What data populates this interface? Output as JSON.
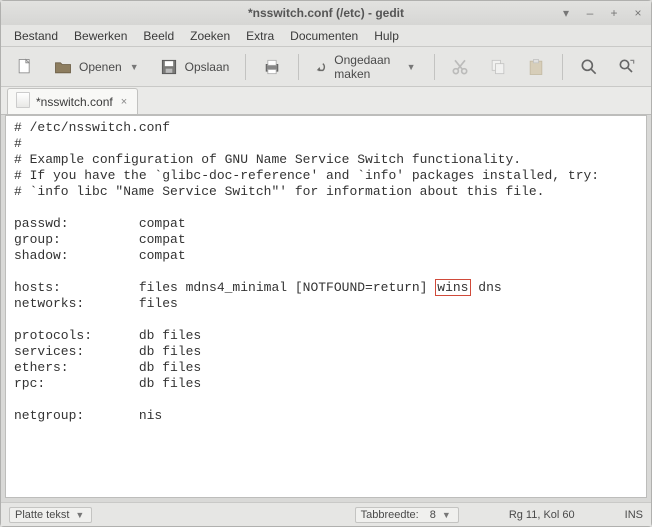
{
  "window": {
    "title": "*nsswitch.conf (/etc) - gedit"
  },
  "menu": {
    "items": [
      "Bestand",
      "Bewerken",
      "Beeld",
      "Zoeken",
      "Extra",
      "Documenten",
      "Hulp"
    ]
  },
  "toolbar": {
    "open_label": "Openen",
    "save_label": "Opslaan",
    "undo_label": "Ongedaan maken"
  },
  "tab": {
    "label": "*nsswitch.conf"
  },
  "editor": {
    "lines": [
      "# /etc/nsswitch.conf",
      "#",
      "# Example configuration of GNU Name Service Switch functionality.",
      "# If you have the `glibc-doc-reference' and `info' packages installed, try:",
      "# `info libc \"Name Service Switch\"' for information about this file.",
      "",
      "passwd:         compat",
      "group:          compat",
      "shadow:         compat",
      "",
      "",
      "networks:       files",
      "",
      "protocols:      db files",
      "services:       db files",
      "ethers:         db files",
      "rpc:            db files",
      "",
      "netgroup:       nis"
    ],
    "hosts_prefix": "hosts:          files mdns4_minimal [NOTFOUND=return] ",
    "hosts_highlight": "wins",
    "hosts_suffix": " dns"
  },
  "status": {
    "syntax_label": "Platte tekst",
    "tabwidth_label": "Tabbreedte:",
    "tabwidth_value": "8",
    "position": "Rg 11, Kol 60",
    "insert_mode": "INS"
  }
}
